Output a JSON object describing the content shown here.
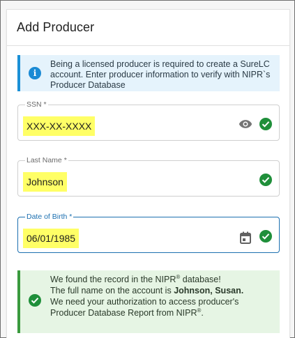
{
  "dialog": {
    "title": "Add Producer"
  },
  "info": {
    "icon": "info-icon",
    "message": "Being a licensed producer is required to create a SureLC account. Enter producer information to verify with NIPR`s Producer Database"
  },
  "fields": {
    "ssn": {
      "label": "SSN *",
      "value": "XXX-XX-XXXX",
      "icon": "eye-icon"
    },
    "last_name": {
      "label": "Last Name *",
      "value": "Johnson"
    },
    "dob": {
      "label": "Date of Birth *",
      "value": "06/01/1985",
      "icon": "calendar-icon"
    }
  },
  "success": {
    "line1_pre": "We found the record in the NIPR",
    "line1_sup": "®",
    "line1_post": " database!",
    "line2_pre": "The full name on the account is ",
    "line2_name": "Johnson, Susan.",
    "line3": "We need your authorization to access producer's",
    "line4_pre": "Producer Database Report from NIPR",
    "line4_sup": "®",
    "line4_post": "."
  },
  "colors": {
    "valid": "#1f8f3a",
    "focus": "#1b6fb0",
    "info_bg": "#e5f3fc",
    "success_bg": "#e6f5e4",
    "highlight": "#ffff66"
  }
}
